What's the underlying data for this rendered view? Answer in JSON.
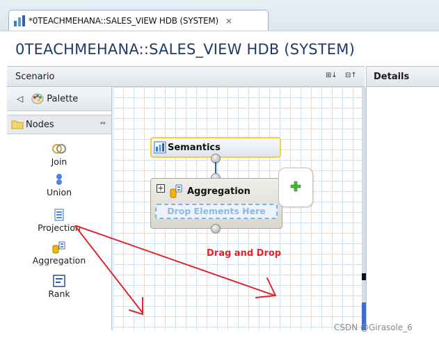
{
  "tab": {
    "label": "*0TEACHMEHANA::SALES_VIEW HDB (SYSTEM)",
    "close_icon": "close-icon",
    "icon": "calculation-view-icon"
  },
  "header": {
    "title": "0TEACHMEHANA::SALES_VIEW HDB (SYSTEM)"
  },
  "scenario": {
    "title": "Scenario",
    "buttons": [
      "⊞↓",
      "⊟↑"
    ]
  },
  "details": {
    "title": "Details"
  },
  "palette": {
    "back_icon": "chevron-left-icon",
    "label": "Palette",
    "nodes_label": "Nodes",
    "tools": [
      {
        "label": "Join",
        "icon": "join-icon"
      },
      {
        "label": "Union",
        "icon": "union-icon"
      },
      {
        "label": "Projection",
        "icon": "projection-icon"
      },
      {
        "label": "Aggregation",
        "icon": "aggregation-icon"
      },
      {
        "label": "Rank",
        "icon": "rank-icon"
      }
    ]
  },
  "canvas": {
    "semantics_label": "Semantics",
    "aggregation_label": "Aggregation",
    "expand_symbol": "+",
    "drop_zone_text": "Drop Elements Here",
    "annotation": "Drag and Drop",
    "add_icon": "plus-icon"
  },
  "colors": {
    "annotation": "#e0242a",
    "semantics_border": "#f3cf38",
    "title": "#1f3a63",
    "grid": "#cfe0ef"
  },
  "watermark": "CSDN @Girasole_6"
}
